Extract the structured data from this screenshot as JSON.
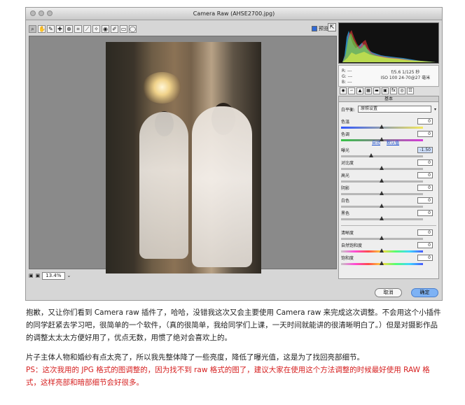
{
  "window": {
    "title": "Camera Raw (AHSE2700.jpg)"
  },
  "toolbar": {
    "tools": [
      "zoom-tool",
      "hand-tool",
      "white-balance-tool",
      "color-sampler-tool",
      "target-adjustment-tool",
      "crop-tool",
      "straighten-tool",
      "spot-removal-tool",
      "red-eye-tool",
      "adjustment-brush-tool",
      "graduated-filter-tool",
      "radial-filter-tool"
    ],
    "preview_label": "预览"
  },
  "zoom": {
    "value": "13.4%"
  },
  "info": {
    "r_label": "R:",
    "g_label": "G:",
    "b_label": "B:",
    "rgb_value": "---",
    "exposure": "f/5.6  1/125 秒",
    "iso": "ISO 100",
    "focal": "24-70@27 毫米"
  },
  "panel": {
    "title": "基本",
    "white_balance_label": "白平衡:",
    "white_balance_value": "原照设置",
    "temp_label": "色温",
    "temp_value": "0",
    "tint_label": "色调",
    "tint_value": "0",
    "auto_label": "自动",
    "default_label": "默认值",
    "exposure_label": "曝光",
    "exposure_value": "-1.50",
    "contrast_label": "对比度",
    "contrast_value": "0",
    "highlights_label": "高光",
    "highlights_value": "0",
    "shadows_label": "阴影",
    "shadows_value": "0",
    "whites_label": "白色",
    "whites_value": "0",
    "blacks_label": "黑色",
    "blacks_value": "0",
    "clarity_label": "清晰度",
    "clarity_value": "0",
    "vibrance_label": "自然饱和度",
    "vibrance_value": "0",
    "saturation_label": "饱和度",
    "saturation_value": "0"
  },
  "buttons": {
    "cancel": "取消",
    "ok": "确定"
  },
  "article": {
    "p1": "抱歉，又让你们看到 Camera raw 插件了，哈哈，没错我这次又会主要使用 Camera raw 来完成这次调整。不会用这个小插件的同学赶紧去学习吧，很简单的一个软件，（真的很简单，我给同学们上课，一天时间就能讲的很清晰明白了。）但是对摄影作品的调整太太太方便好用了，优点无数，用惯了绝对会喜欢上的。",
    "p2": "片子主体人物和婚纱有点太亮了，所以我先整体降了一些亮度，降低了曝光值，这是为了找回亮部细节。",
    "p3": "PS：这次我用的 JPG 格式的图调整的，因为找不到 raw 格式的图了，建议大家在使用这个方法调整的时候最好使用 RAW 格式，这样亮部和暗部细节会好很多。"
  }
}
